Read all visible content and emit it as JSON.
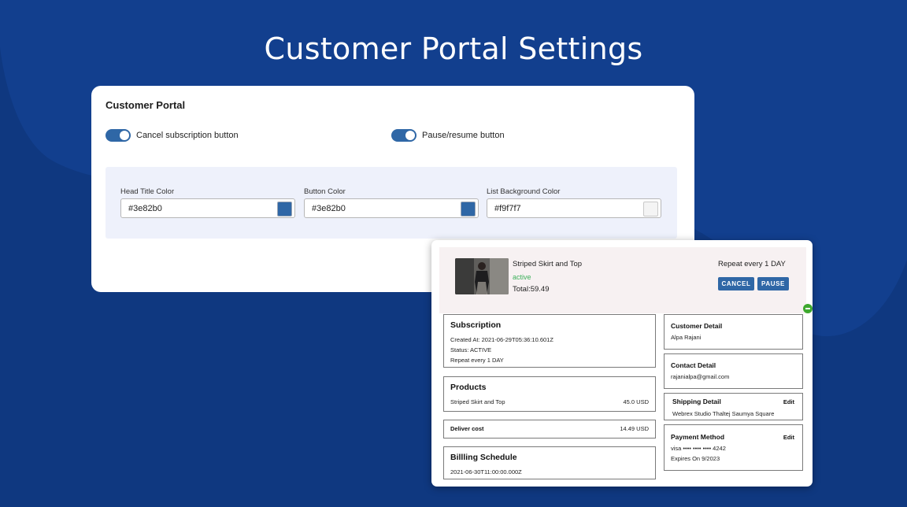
{
  "page": {
    "heading": "Customer Portal Settings"
  },
  "card": {
    "title": "Customer Portal",
    "toggles": [
      {
        "label": "Cancel subscription button",
        "on": true
      },
      {
        "label": "Pause/resume button",
        "on": true
      }
    ],
    "colors": [
      {
        "label": "Head Title Color",
        "value": "#3e82b0",
        "swatch": "#2f67a6"
      },
      {
        "label": "Button Color",
        "value": "#3e82b0",
        "swatch": "#2f67a6"
      },
      {
        "label": "List Background Color",
        "value": "#f9f7f7",
        "swatch": "#f4f4f4"
      }
    ]
  },
  "preview": {
    "product": {
      "name": "Striped Skirt and Top",
      "status": "active",
      "total": "Total:59.49"
    },
    "repeat": "Repeat every 1 DAY",
    "buttons": {
      "cancel": "CANCEL",
      "pause": "PAUSE"
    },
    "subscription": {
      "title": "Subscription",
      "created": "Created At: 2021-06-29T05:36:10.601Z",
      "status": "Status: ACTIVE",
      "repeat": "Repeat every 1 DAY"
    },
    "products": {
      "title": "Products",
      "item": "Striped Skirt and Top",
      "price": "45.0 USD"
    },
    "deliver": {
      "label": "Deliver cost",
      "price": "14.49 USD"
    },
    "billing": {
      "title": "Billling Schedule",
      "date": "2021-06-30T11:00:00.000Z"
    },
    "customer": {
      "title": "Customer Detail",
      "name": "Alpa Rajani"
    },
    "contact": {
      "title": "Contact Detail",
      "email": "rajanialpa@gmail.com"
    },
    "shipping": {
      "title": "Shipping Detail",
      "edit": "Edit",
      "address": "Webrex Studio Thaltej Saumya Square"
    },
    "payment": {
      "title": "Payment Method",
      "edit": "Edit",
      "card": "visa •••• •••• •••• 4242",
      "expires": "Expires On 9/2023"
    }
  },
  "colors": {
    "background": "#0f3880",
    "blob": "#123f8e",
    "accent": "#2f67a6",
    "active": "#3cb05a"
  }
}
